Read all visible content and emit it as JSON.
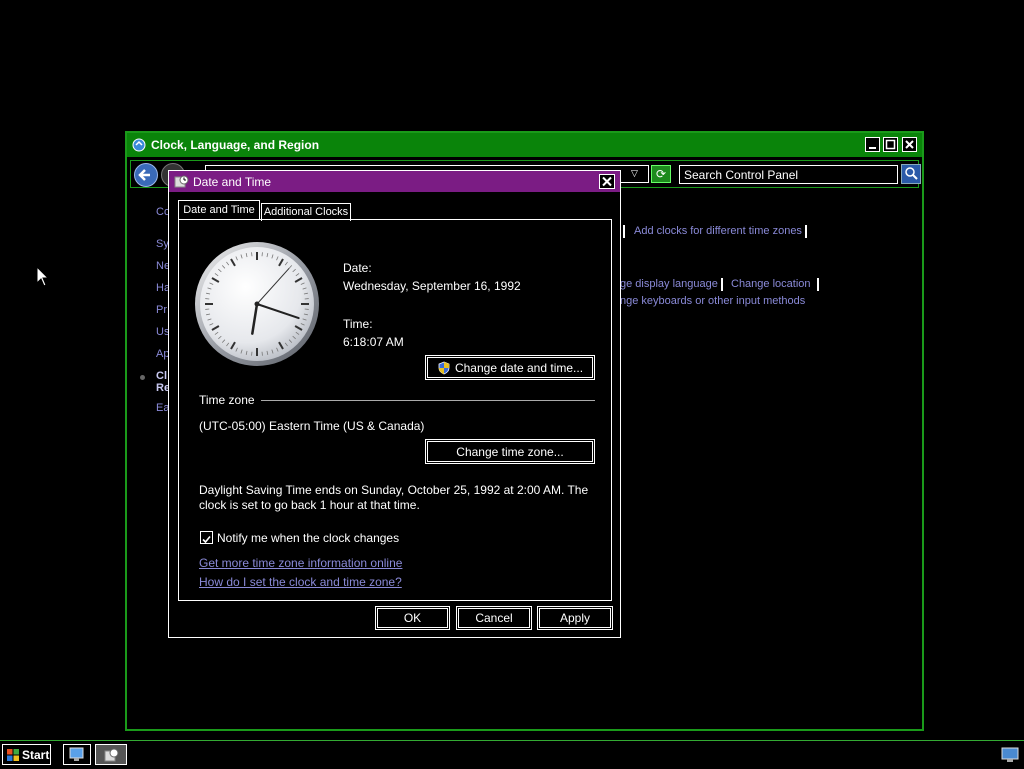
{
  "control_panel": {
    "title": "Clock, Language, and Region",
    "search_placeholder": "Search Control Panel",
    "side_links": [
      "Co",
      "Sy",
      "Ne",
      "Ha",
      "Pr",
      "Us",
      "Ap",
      "Cl",
      "Re",
      "Ea"
    ],
    "tasks": {
      "add_clocks": "Add clocks for different time zones",
      "display_language": "ge display language",
      "change_location": "Change location",
      "keyboards": "nge keyboards or other input methods"
    }
  },
  "dialog": {
    "title": "Date and Time",
    "tabs": [
      "Date and Time",
      "Additional Clocks"
    ],
    "date_label": "Date:",
    "date_value": "Wednesday, September 16, 1992",
    "time_label": "Time:",
    "time_value": "6:18:07 AM",
    "change_datetime_button": "Change date and time...",
    "timezone_section": "Time zone",
    "timezone_value": "(UTC-05:00) Eastern Time (US & Canada)",
    "change_timezone_button": "Change time zone...",
    "dst_line1": "Daylight Saving Time ends on Sunday, October 25, 1992 at 2:00 AM. The",
    "dst_line2": "clock is set to go back 1 hour at that time.",
    "notify_checkbox": "Notify me when the clock changes",
    "notify_checked": true,
    "link_more_info": "Get more time zone information online",
    "link_how_set": "How do I set the clock and time zone?",
    "ok_button": "OK",
    "cancel_button": "Cancel",
    "apply_button": "Apply",
    "clock": {
      "hours": 6,
      "minutes": 18,
      "seconds": 7
    }
  },
  "taskbar": {
    "start_label": "Start"
  },
  "colors": {
    "cp_border": "#1a9a1a",
    "cp_title": "#0a840a",
    "dialog_title": "#7b1c84",
    "link": "#8a8ad8"
  }
}
